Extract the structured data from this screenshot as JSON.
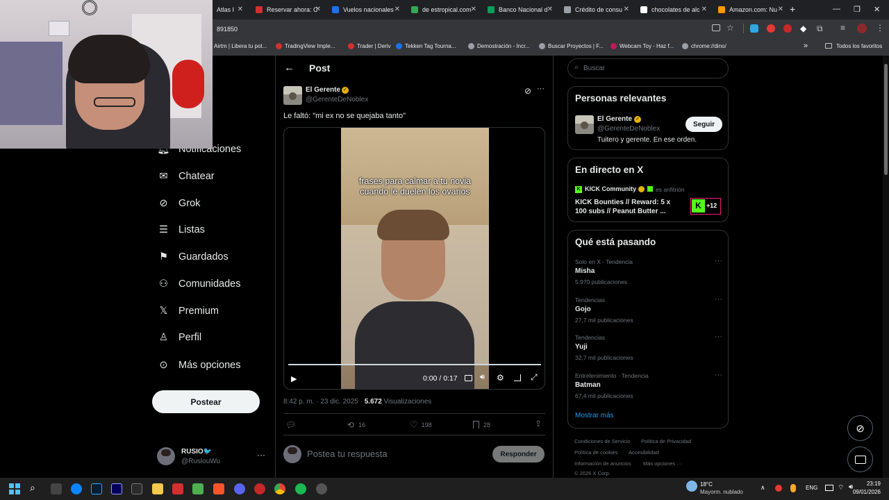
{
  "browser": {
    "tabs": [
      {
        "title": "Atlas I",
        "color": "#4b6cb7"
      },
      {
        "title": "Reservar ahora: C",
        "color": "#d32f2f"
      },
      {
        "title": "Vuelos nacionales",
        "color": "#1a73e8"
      },
      {
        "title": "de estropical.com",
        "color": "#34a853"
      },
      {
        "title": "Banco Nacional d",
        "color": "#0f9d58"
      },
      {
        "title": "Crédito de consu",
        "color": "#9aa0a6"
      },
      {
        "title": "chocolates de alc",
        "color": "#ffffff"
      },
      {
        "title": "Amazon.com: Nu",
        "color": "#ff9900"
      }
    ],
    "url": "891850",
    "bookmarks": [
      {
        "label": "Airtm | Libera tu pot...",
        "color": "#7b61ff"
      },
      {
        "label": "TradingView Imple...",
        "color": "#d32f2f"
      },
      {
        "label": "Trader | Deriv",
        "color": "#d32f2f"
      },
      {
        "label": "Tekken Tag Tourna...",
        "color": "#1a73e8"
      },
      {
        "label": "Demostración - Incr...",
        "color": "#9aa0a6"
      },
      {
        "label": "Buscar Proyectos | F...",
        "color": "#9aa0a6"
      },
      {
        "label": "Webcam Toy - Haz f...",
        "color": "#c2185b"
      },
      {
        "label": "chrome://dino/",
        "color": "#9aa0a6"
      }
    ],
    "all_bookmarks": "Todos los favoritos"
  },
  "sidebar": {
    "items": [
      {
        "label": "Notificaciones",
        "icon": "bell-icon"
      },
      {
        "label": "Chatear",
        "icon": "mail-icon"
      },
      {
        "label": "Grok",
        "icon": "grok-icon"
      },
      {
        "label": "Listas",
        "icon": "list-icon"
      },
      {
        "label": "Guardados",
        "icon": "bookmark-icon"
      },
      {
        "label": "Comunidades",
        "icon": "communities-icon"
      },
      {
        "label": "Premium",
        "icon": "x-logo-icon"
      },
      {
        "label": "Perfil",
        "icon": "person-icon"
      },
      {
        "label": "Más opciones",
        "icon": "more-circle-icon"
      }
    ],
    "post_button": "Postear",
    "account": {
      "name": "RUSIO🐦",
      "handle": "@RuslouWu"
    }
  },
  "post": {
    "header": "Post",
    "author": "El Gerente",
    "handle": "@GerenteDeNoblex",
    "text": "Le faltó: \"mi ex no se quejaba tanto\"",
    "video_caption": "frases para calmar a tu novia cuando le duelen los ovarios",
    "video_time": "0:00 / 0:17",
    "timestamp": "8:42 p. m. · 23 dic. 2025 · ",
    "views_count": "5.672",
    "views_label": " Visualizaciones",
    "reposts": "16",
    "likes": "198",
    "bookmarks": "28",
    "reply_placeholder": "Postea tu respuesta",
    "reply_button": "Responder"
  },
  "right": {
    "search_placeholder": "Buscar",
    "relevant_title": "Personas relevantes",
    "relevant_name": "El Gerente",
    "relevant_handle": "@GerenteDeNoblex",
    "relevant_bio": "Tuitero y gerente. En ese orden.",
    "follow": "Seguir",
    "live_title": "En directo en X",
    "live_host": "KICK Community",
    "live_host_suffix": "es anfitrión",
    "live_text": "KICK Bounties // Reward: 5 x 100 subs // Peanut Butter ...",
    "live_plus": "+12",
    "trends_title": "Qué está pasando",
    "trends": [
      {
        "meta": "Solo en X · Tendencia",
        "name": "Misha",
        "count": "5.970 publicaciones"
      },
      {
        "meta": "Tendencias",
        "name": "Gojo",
        "count": "27,7 mil publicaciones"
      },
      {
        "meta": "Tendencias",
        "name": "Yuji",
        "count": "32,7 mil publicaciones"
      },
      {
        "meta": "Entretenimiento · Tendencia",
        "name": "Batman",
        "count": "67,4 mil publicaciones"
      }
    ],
    "show_more": "Mostrar más",
    "footer": [
      "Condiciones de Servicio",
      "Política de Privacidad",
      "Política de cookies",
      "Accesibilidad",
      "Información de anuncios",
      "Más opciones ···",
      "© 2026 X Corp."
    ]
  },
  "taskbar": {
    "weather_temp": "18°C",
    "weather_desc": "Mayorm. nublado",
    "lang": "ENG",
    "time": "23:19",
    "date": "09/01/2026"
  },
  "colors": {
    "accent": "#1d9bf0",
    "verified": "#e7b10a",
    "kick": "#53fc18"
  }
}
